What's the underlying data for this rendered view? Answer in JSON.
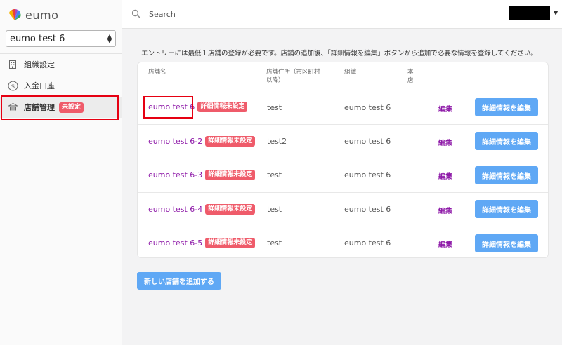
{
  "app": {
    "logo_text": "eumo"
  },
  "sidebar": {
    "org_select_value": "eumo test 6",
    "items": [
      {
        "label": "組織設定",
        "icon": "building-icon"
      },
      {
        "label": "入金口座",
        "icon": "dollar-circle-icon"
      },
      {
        "label": "店舗管理",
        "icon": "bank-icon",
        "badge": "未設定"
      }
    ]
  },
  "header": {
    "search_placeholder": "Search"
  },
  "main": {
    "notice": "エントリーには最低１店舗の登録が必要です。店舗の追加後、「詳細情報を編集」ボタンから追加で必要な情報を登録してください。",
    "columns": [
      "店舗名",
      "店舗住所（市区町村以降）",
      "組織",
      "本店"
    ],
    "rows": [
      {
        "name": "eumo test 6",
        "badge": "詳細情報未設定",
        "address": "test",
        "org": "eumo test 6",
        "edit": "編集",
        "detail_button": "詳細情報を編集"
      },
      {
        "name": "eumo test 6-2",
        "badge": "詳細情報未設定",
        "address": "test2",
        "org": "eumo test 6",
        "edit": "編集",
        "detail_button": "詳細情報を編集"
      },
      {
        "name": "eumo test 6-3",
        "badge": "詳細情報未設定",
        "address": "test",
        "org": "eumo test 6",
        "edit": "編集",
        "detail_button": "詳細情報を編集"
      },
      {
        "name": "eumo test 6-4",
        "badge": "詳細情報未設定",
        "address": "test",
        "org": "eumo test 6",
        "edit": "編集",
        "detail_button": "詳細情報を編集"
      },
      {
        "name": "eumo test 6-5",
        "badge": "詳細情報未設定",
        "address": "test",
        "org": "eumo test 6",
        "edit": "編集",
        "detail_button": "詳細情報を編集"
      }
    ],
    "add_button": "新しい店舗を追加する"
  },
  "colors": {
    "accent_button": "#5fa8f5",
    "link": "#8e1aa8",
    "badge": "#ef5b6a",
    "highlight": "#e60012"
  }
}
